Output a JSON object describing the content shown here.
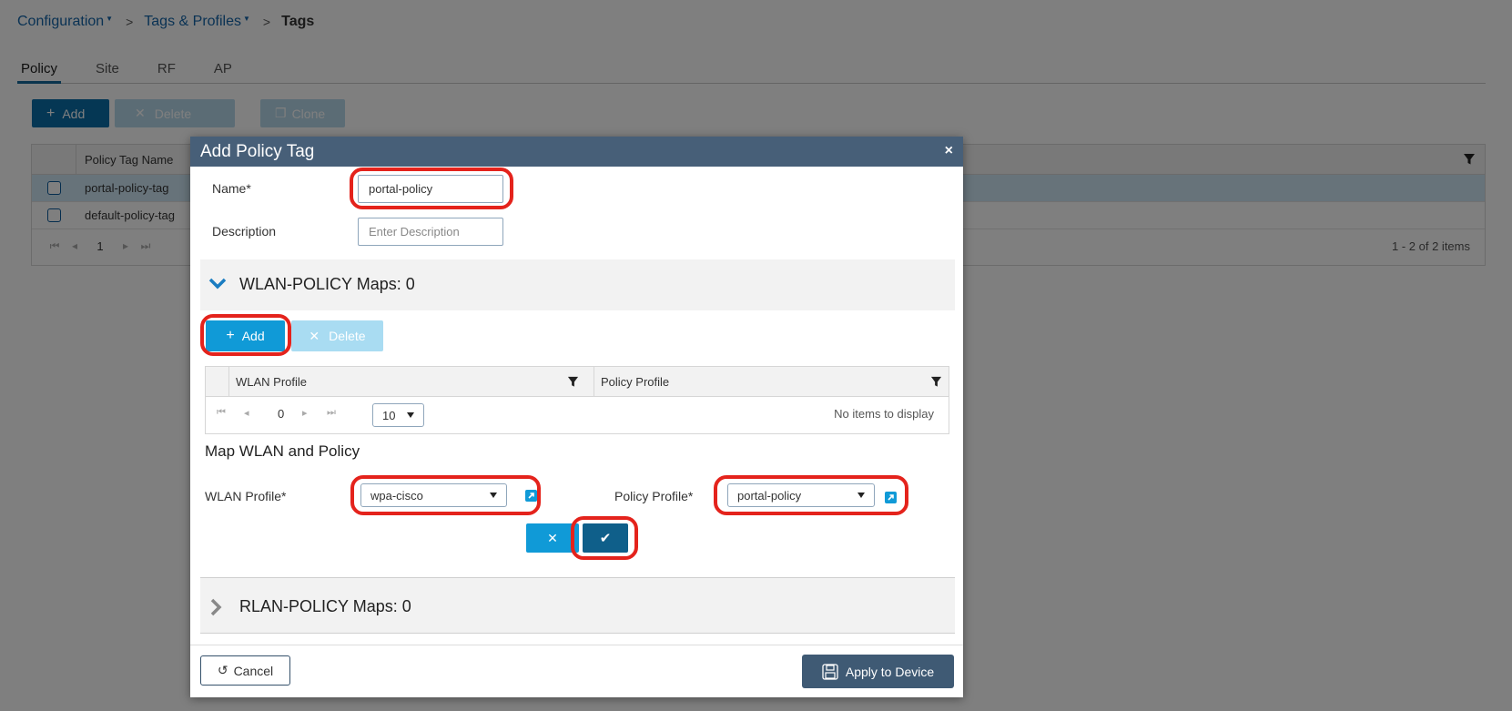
{
  "breadcrumb": {
    "configuration": "Configuration",
    "tags_profiles": "Tags & Profiles",
    "current": "Tags",
    "separator": ">"
  },
  "tabs": [
    "Policy",
    "Site",
    "RF",
    "AP"
  ],
  "toolbar": {
    "add": "Add",
    "delete": "Delete",
    "clone": "Clone"
  },
  "grid": {
    "column": "Policy Tag Name",
    "rows": [
      "portal-policy-tag",
      "default-policy-tag"
    ],
    "page": "1",
    "summary": "1 - 2 of 2 items"
  },
  "modal": {
    "title": "Add Policy Tag",
    "close": "×",
    "name_label": "Name*",
    "name_value": "portal-policy",
    "description_label": "Description",
    "description_placeholder": "Enter Description",
    "wlan_section": "WLAN-POLICY Maps: 0",
    "add": "Add",
    "delete": "Delete",
    "col_wlan": "WLAN Profile",
    "col_policy": "Policy Profile",
    "page": "0",
    "page_size": "10",
    "no_items": "No items to display",
    "map_heading": "Map WLAN and Policy",
    "wlan_profile_label": "WLAN Profile*",
    "wlan_profile_value": "wpa-cisco",
    "policy_profile_label": "Policy Profile*",
    "policy_profile_value": "portal-policy",
    "rlan_section": "RLAN-POLICY Maps: 0",
    "cancel": "Cancel",
    "apply": "Apply to Device"
  },
  "colors": {
    "header": "#475f78",
    "primary": "#109ad7",
    "highlight_ring": "#e4231c"
  }
}
